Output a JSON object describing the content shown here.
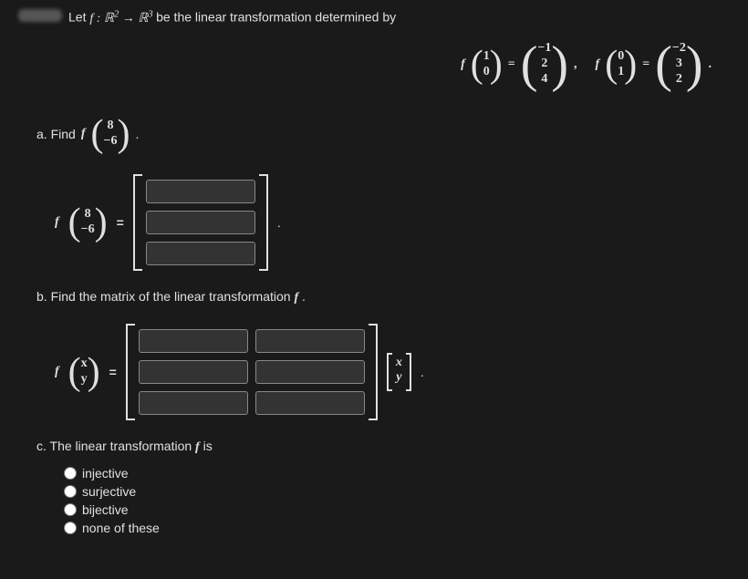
{
  "intro": {
    "prefix": "Let ",
    "func": "f : ℝ",
    "exp1": "2",
    "arrow": " → ℝ",
    "exp2": "3",
    "suffix": " be the linear transformation determined by"
  },
  "defs": {
    "f": "f",
    "eq": "=",
    "comma": ",",
    "period": ".",
    "v1": {
      "a": "1",
      "b": "0"
    },
    "r1": {
      "a": "−1",
      "b": "2",
      "c": "4"
    },
    "v2": {
      "a": "0",
      "b": "1"
    },
    "r2": {
      "a": "−2",
      "b": "3",
      "c": "2"
    }
  },
  "partA": {
    "label": "a. Find ",
    "f": "f",
    "vec": {
      "a": "8",
      "b": "−6"
    },
    "period": ".",
    "eq": "="
  },
  "partB": {
    "label": "b. Find the matrix of the linear transformation ",
    "f": "f",
    "period": ".",
    "eq": "=",
    "vec": {
      "a": "x",
      "b": "y"
    }
  },
  "partC": {
    "label": "c. The linear transformation ",
    "f": "f",
    "suffix": " is",
    "options": {
      "o1": "injective",
      "o2": "surjective",
      "o3": "bijective",
      "o4": "none of these"
    }
  }
}
